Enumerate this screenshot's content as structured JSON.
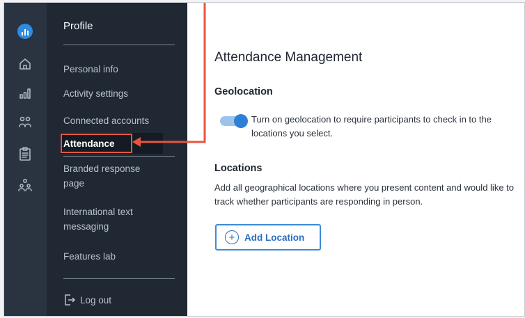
{
  "sidebar": {
    "title": "Profile",
    "items": [
      {
        "label": "Personal info"
      },
      {
        "label": "Activity settings"
      },
      {
        "label": "Connected accounts"
      },
      {
        "label": "Attendance"
      },
      {
        "label": "Branded response page"
      },
      {
        "label": "International text messaging"
      },
      {
        "label": "Features lab"
      }
    ],
    "logout_label": "Log out"
  },
  "rail": {
    "icons": [
      "logo-icon",
      "home-icon",
      "bar-chart-icon",
      "users-icon",
      "clipboard-icon",
      "audience-icon"
    ]
  },
  "main": {
    "title": "Attendance Management",
    "geolocation": {
      "heading": "Geolocation",
      "toggle_on": true,
      "description": "Turn on geolocation to require participants to check in to the locations you select."
    },
    "locations": {
      "heading": "Locations",
      "description": "Add all geographical locations where you present content and would like to track whether participants are responding in person.",
      "add_button_label": "Add Location"
    }
  },
  "colors": {
    "accent": "#2f80d4",
    "callout": "#e8553f",
    "sidebar_bg": "#1f2833",
    "rail_bg": "#2a3340"
  }
}
